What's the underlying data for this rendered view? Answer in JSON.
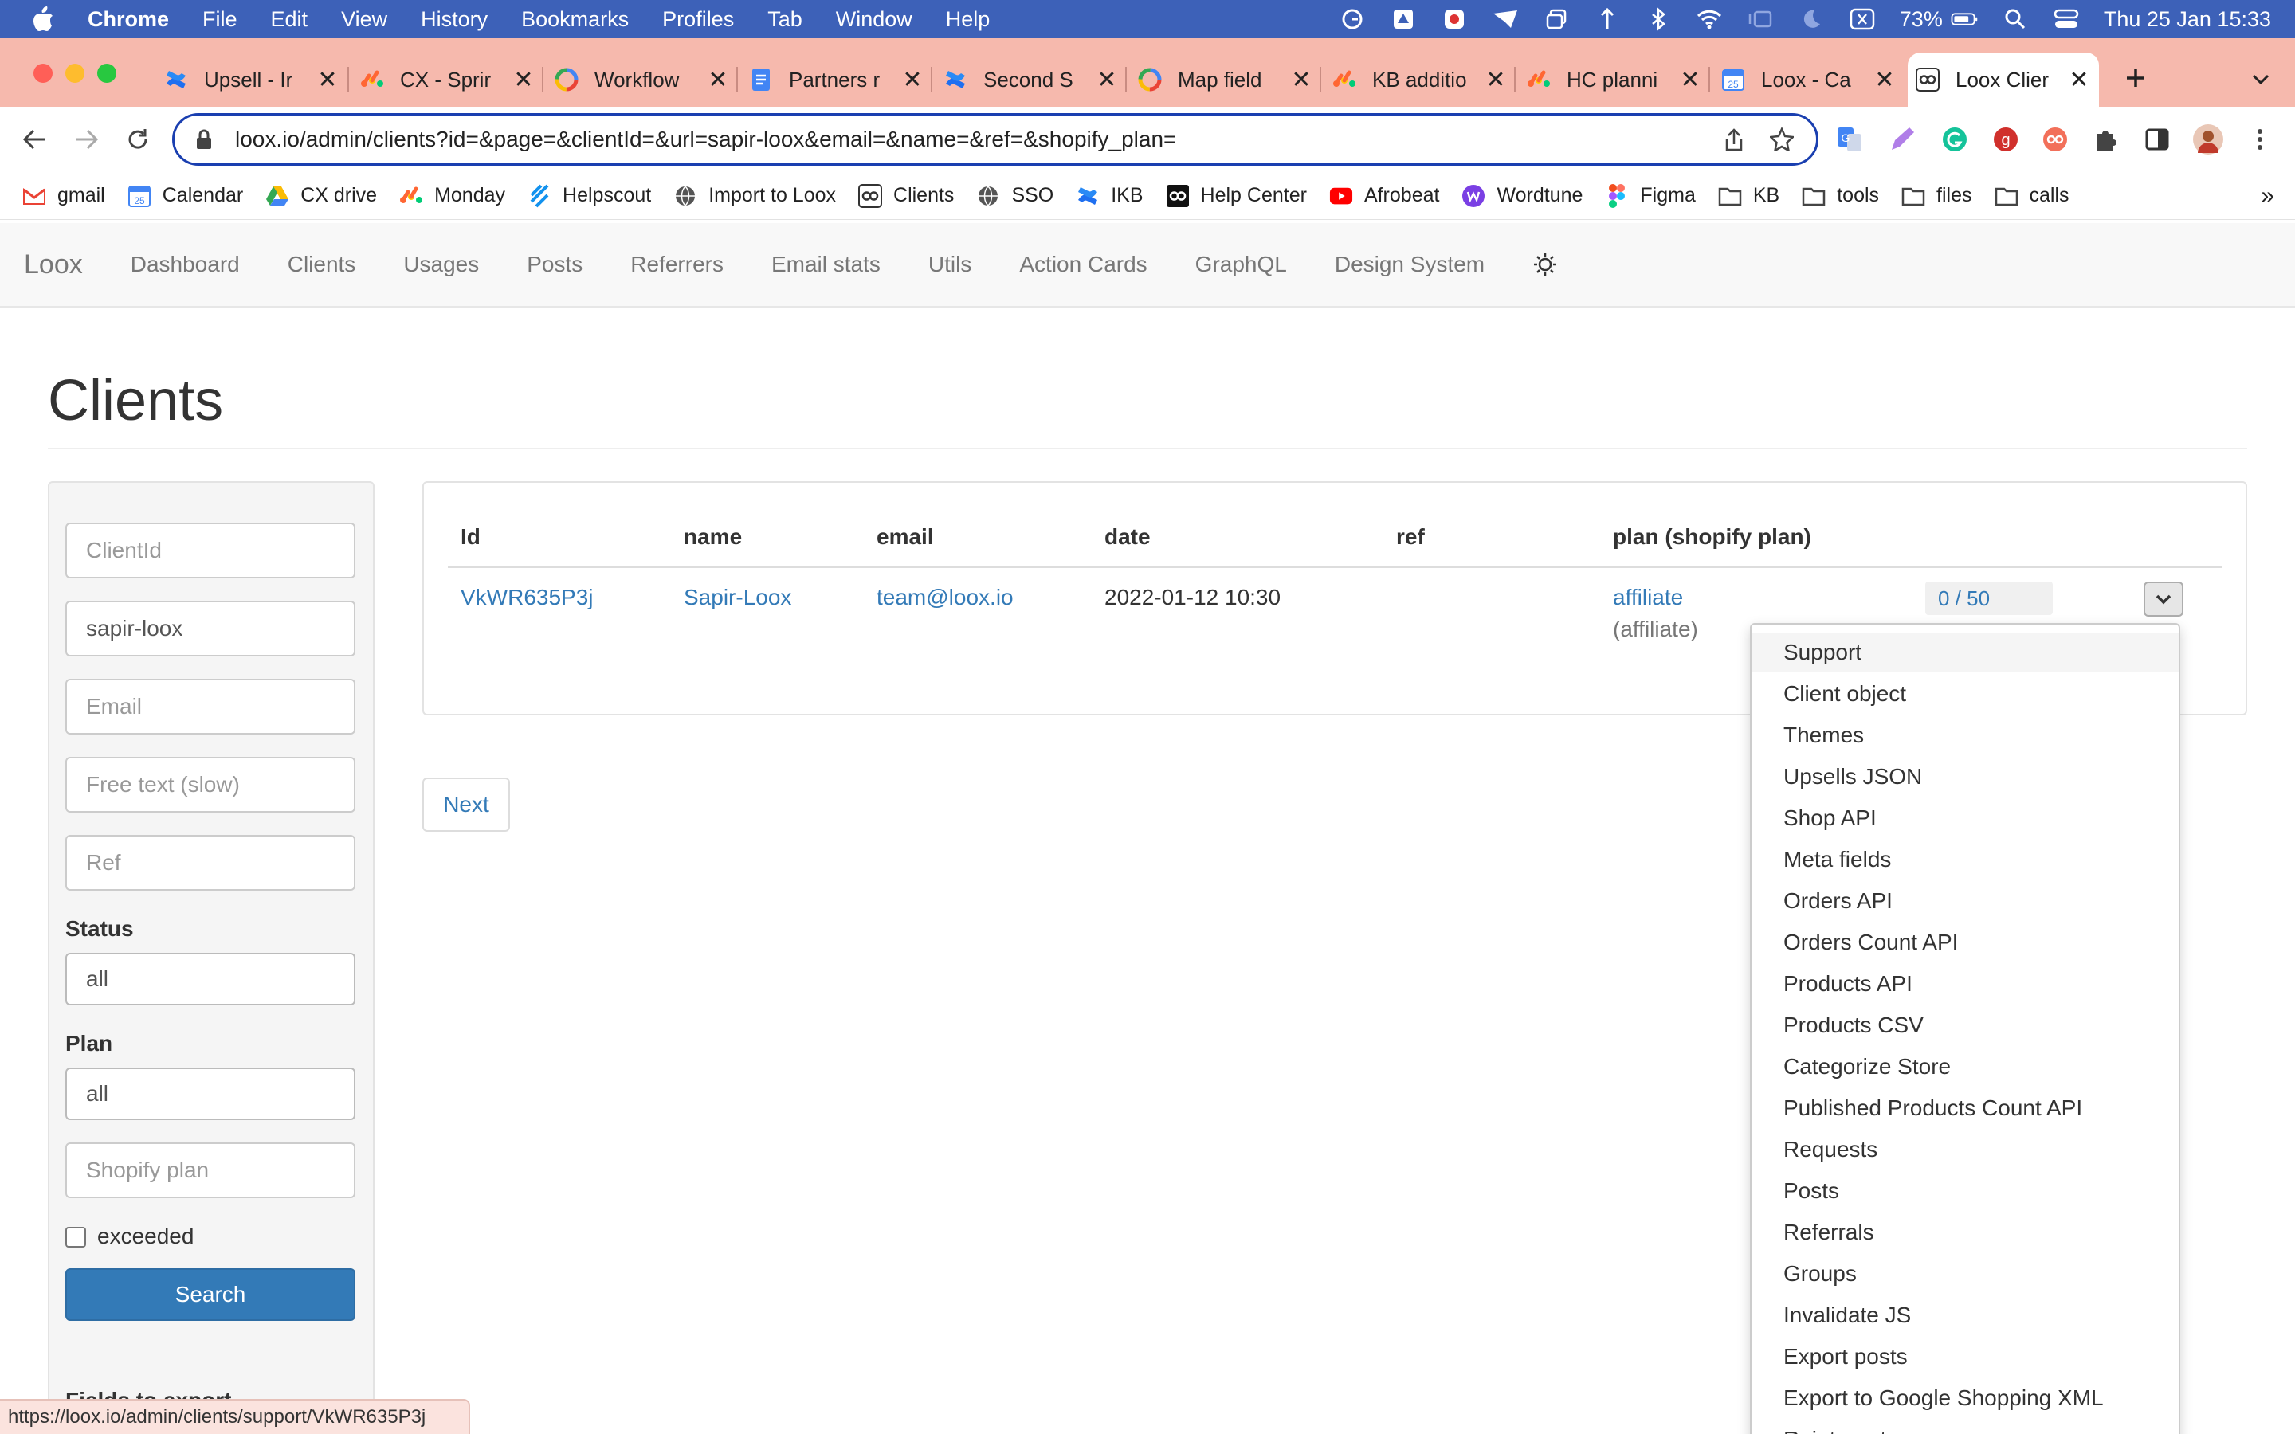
{
  "menubar": {
    "app": "Chrome",
    "items": [
      "File",
      "Edit",
      "View",
      "History",
      "Bookmarks",
      "Profiles",
      "Tab",
      "Window",
      "Help"
    ],
    "battery": "73%",
    "datetime": "Thu 25 Jan  15:33"
  },
  "tabs": [
    {
      "label": "Upsell - Ir",
      "icon": "confluence-icon"
    },
    {
      "label": "CX - Sprir",
      "icon": "monday-icon"
    },
    {
      "label": "Workflow",
      "icon": "google-icon"
    },
    {
      "label": "Partners r",
      "icon": "docs-icon"
    },
    {
      "label": "Second S",
      "icon": "confluence-icon"
    },
    {
      "label": "Map field",
      "icon": "google-icon"
    },
    {
      "label": "KB additio",
      "icon": "monday-icon"
    },
    {
      "label": "HC planni",
      "icon": "monday-icon"
    },
    {
      "label": "Loox - Ca",
      "icon": "calendar-icon"
    },
    {
      "label": "Loox Clier",
      "icon": "loox-icon",
      "active": true
    }
  ],
  "toolbar": {
    "url": "loox.io/admin/clients?id=&page=&clientId=&url=sapir-loox&email=&name=&ref=&shopify_plan="
  },
  "bookmarks": [
    {
      "label": "gmail",
      "icon": "gmail-icon"
    },
    {
      "label": "Calendar",
      "icon": "calendar-icon"
    },
    {
      "label": "CX drive",
      "icon": "drive-icon"
    },
    {
      "label": "Monday",
      "icon": "monday-icon"
    },
    {
      "label": "Helpscout",
      "icon": "helpscout-icon"
    },
    {
      "label": "Import to Loox",
      "icon": "globe-icon"
    },
    {
      "label": "Clients",
      "icon": "loox-icon"
    },
    {
      "label": "SSO",
      "icon": "globe-icon"
    },
    {
      "label": "IKB",
      "icon": "confluence-icon"
    },
    {
      "label": "Help Center",
      "icon": "loox-icon"
    },
    {
      "label": "Afrobeat",
      "icon": "youtube-icon"
    },
    {
      "label": "Wordtune",
      "icon": "wordtune-icon"
    },
    {
      "label": "Figma",
      "icon": "figma-icon"
    },
    {
      "label": "KB",
      "icon": "folder-icon"
    },
    {
      "label": "tools",
      "icon": "folder-icon"
    },
    {
      "label": "files",
      "icon": "folder-icon"
    },
    {
      "label": "calls",
      "icon": "folder-icon"
    }
  ],
  "bookmarks_more": "»",
  "nav": {
    "brand": "Loox",
    "links": [
      "Dashboard",
      "Clients",
      "Usages",
      "Posts",
      "Referrers",
      "Email stats",
      "Utils",
      "Action Cards",
      "GraphQL",
      "Design System"
    ]
  },
  "page": {
    "title": "Clients"
  },
  "filters": {
    "client_id_placeholder": "ClientId",
    "url_value": "sapir-loox",
    "email_placeholder": "Email",
    "free_text_placeholder": "Free text (slow)",
    "ref_placeholder": "Ref",
    "status_label": "Status",
    "status_value": "all",
    "plan_label": "Plan",
    "plan_value": "all",
    "shopify_plan_placeholder": "Shopify plan",
    "exceeded_label": "exceeded",
    "search_label": "Search",
    "fields_to_export": "Fields to export"
  },
  "table": {
    "headers": [
      "Id",
      "name",
      "email",
      "date",
      "ref",
      "plan (shopify plan)"
    ],
    "row": {
      "id": "VkWR635P3j",
      "name": "Sapir-Loox",
      "email": "team@loox.io",
      "date": "2022-01-12 10:30",
      "ref": "",
      "plan": "affiliate",
      "shopify_plan": "(affiliate)",
      "usage": "0 / 50"
    }
  },
  "pagination": {
    "next": "Next"
  },
  "dropdown": {
    "items": [
      "Support",
      "Client object",
      "Themes",
      "Upsells JSON",
      "Shop API",
      "Meta fields",
      "Orders API",
      "Orders Count API",
      "Products API",
      "Products CSV",
      "Categorize Store",
      "Published Products Count API",
      "Requests",
      "Posts",
      "Referrals",
      "Groups",
      "Invalidate JS",
      "Export posts",
      "Export to Google Shopping XML",
      "Reintegrate"
    ]
  },
  "statusbar": {
    "url": "https://loox.io/admin/clients/support/VkWR635P3j"
  },
  "colors": {
    "link": "#337ab7",
    "primary": "#337ab7",
    "tabstrip": "#f6b9ad",
    "menubar": "#3d61b8"
  }
}
